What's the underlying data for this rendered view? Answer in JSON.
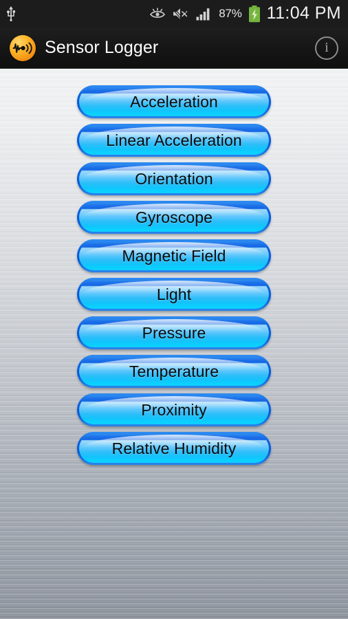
{
  "status_bar": {
    "left_icons": [
      {
        "name": "usb-icon",
        "glyph": "usb"
      }
    ],
    "right_icons": [
      {
        "name": "eye-care-icon",
        "glyph": "eye"
      },
      {
        "name": "mute-vibrate-off-icon",
        "glyph": "speaker-muted"
      },
      {
        "name": "signal-strength-icon",
        "glyph": "signal-bars"
      }
    ],
    "battery_percent": "87%",
    "battery_state": "charging",
    "battery_color": "#7cc242",
    "clock": "11:04 PM",
    "background_color": "#1c1c1c",
    "text_color": "#f2f2f2"
  },
  "action_bar": {
    "app_icon_name": "sensor-logger-waveform-icon",
    "app_icon_color": "#ffb02e",
    "title": "Sensor Logger",
    "info_button_label": "i",
    "background_color": "#151515"
  },
  "main": {
    "background_style": "brushed-metal",
    "buttons": [
      {
        "id": "acceleration",
        "label": "Acceleration"
      },
      {
        "id": "linear-acceleration",
        "label": "Linear Acceleration"
      },
      {
        "id": "orientation",
        "label": "Orientation"
      },
      {
        "id": "gyroscope",
        "label": "Gyroscope"
      },
      {
        "id": "magnetic-field",
        "label": "Magnetic Field"
      },
      {
        "id": "light",
        "label": "Light"
      },
      {
        "id": "pressure",
        "label": "Pressure"
      },
      {
        "id": "temperature",
        "label": "Temperature"
      },
      {
        "id": "proximity",
        "label": "Proximity"
      },
      {
        "id": "relative-humidity",
        "label": "Relative Humidity"
      }
    ],
    "button_colors": {
      "border": "#0b5fe0",
      "fill_top": "#9fd8f8",
      "fill_bottom": "#09d2ff",
      "text": "#0a0a0a"
    }
  }
}
